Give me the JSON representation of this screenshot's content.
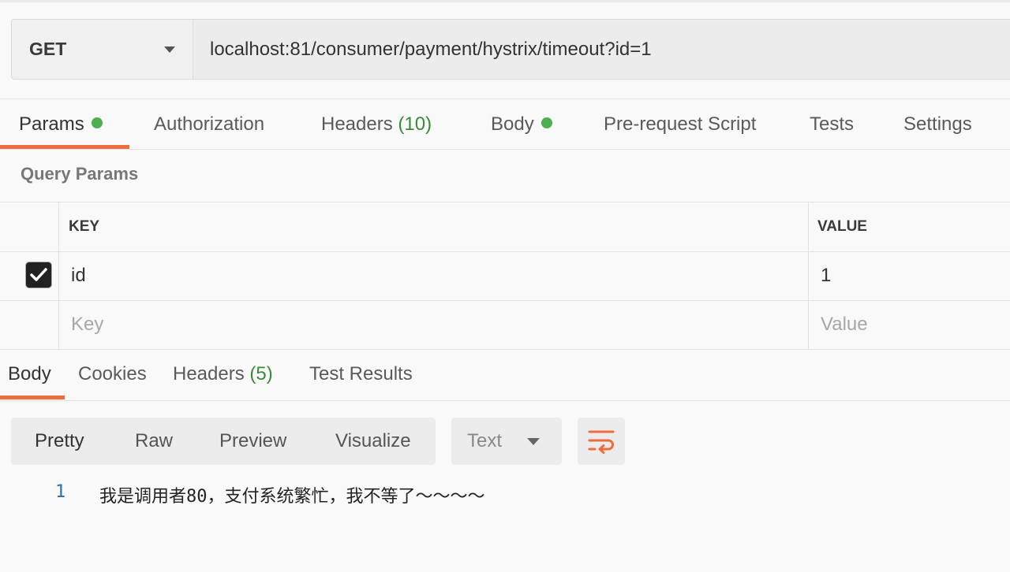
{
  "request": {
    "method": "GET",
    "url": "localhost:81/consumer/payment/hystrix/timeout?id=1"
  },
  "request_tabs": {
    "params": "Params",
    "authorization": "Authorization",
    "headers": "Headers",
    "headers_count": "(10)",
    "body": "Body",
    "pre_request": "Pre-request Script",
    "tests": "Tests",
    "settings": "Settings"
  },
  "query_params": {
    "title": "Query Params",
    "key_header": "KEY",
    "value_header": "VALUE",
    "rows": [
      {
        "key": "id",
        "value": "1",
        "checked": true
      }
    ],
    "key_placeholder": "Key",
    "value_placeholder": "Value"
  },
  "response_tabs": {
    "body": "Body",
    "cookies": "Cookies",
    "headers": "Headers",
    "headers_count": "(5)",
    "test_results": "Test Results"
  },
  "format": {
    "pretty": "Pretty",
    "raw": "Raw",
    "preview": "Preview",
    "visualize": "Visualize",
    "type": "Text",
    "wrap_icon": "wrap-lines-icon"
  },
  "response_body": {
    "lines": [
      {
        "num": "1",
        "text": "我是调用者80，支付系统繁忙，我不等了～～～～"
      }
    ]
  },
  "colors": {
    "accent": "#ef6c3e",
    "status_dot": "#4caf50",
    "count_green": "#3a8a3a"
  }
}
